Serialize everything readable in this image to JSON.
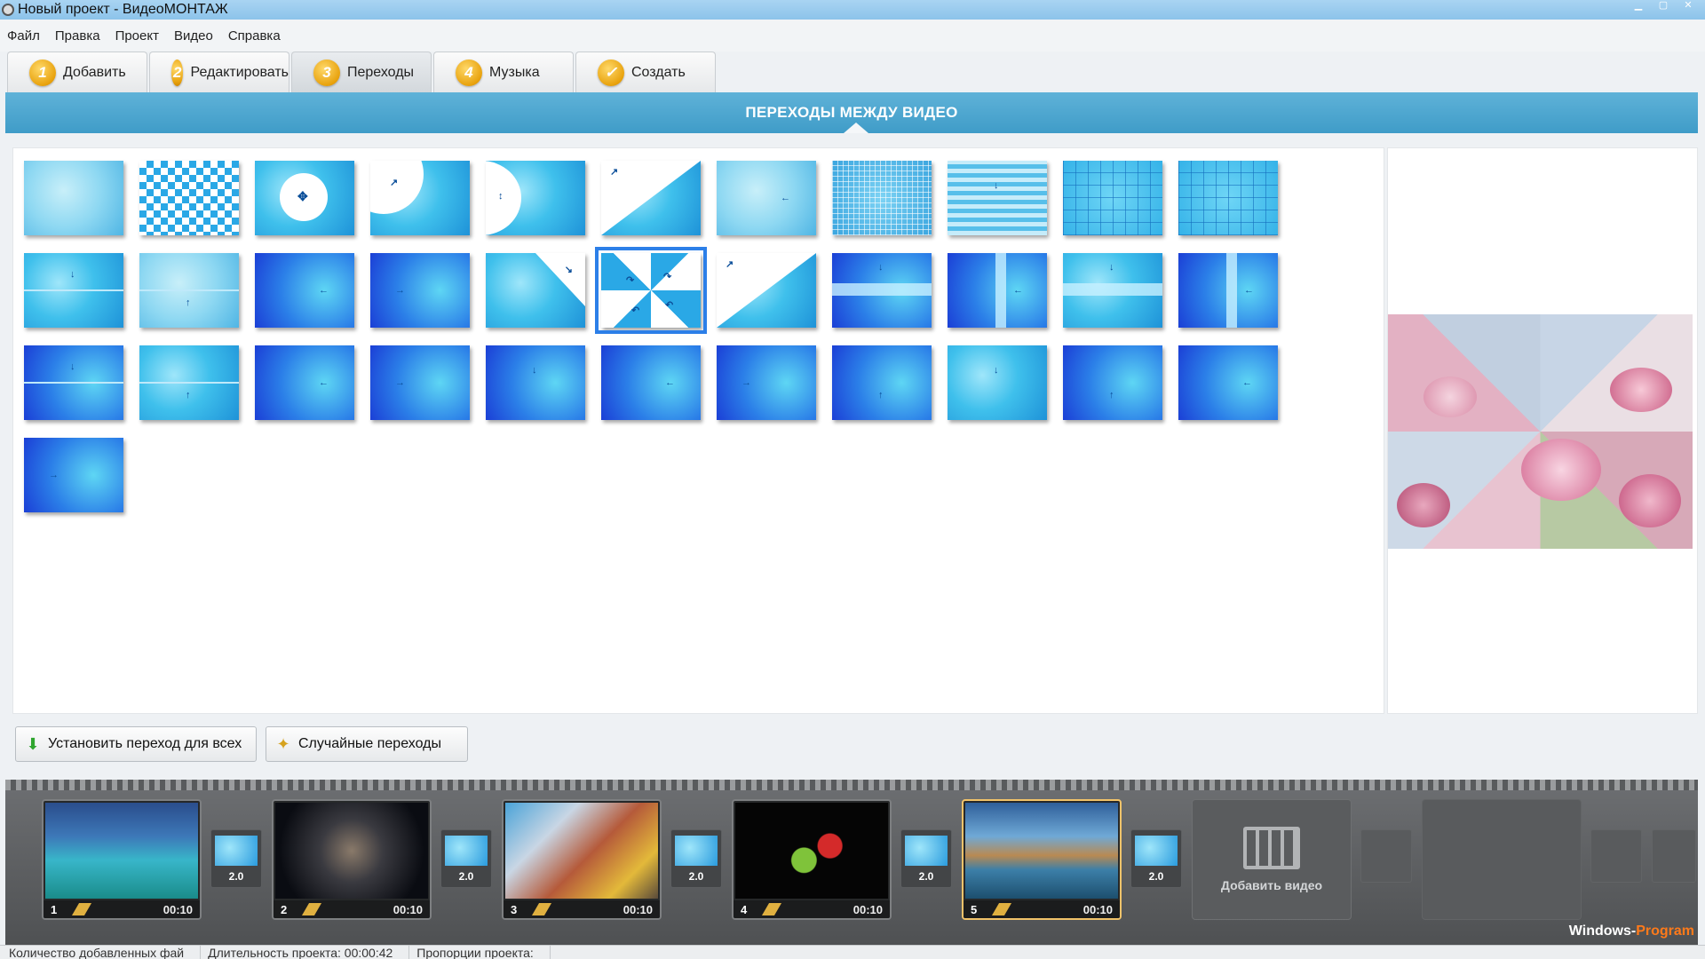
{
  "window": {
    "title": "Новый проект - ВидеоМОНТАЖ",
    "controls": [
      "minimize-icon",
      "restore-icon",
      "close-icon"
    ]
  },
  "menu": [
    "Файл",
    "Правка",
    "Проект",
    "Видео",
    "Справка"
  ],
  "tabs": [
    {
      "badge": "1",
      "label": "Добавить"
    },
    {
      "badge": "2",
      "label": "Редактировать"
    },
    {
      "badge": "3",
      "label": "Переходы",
      "active": true
    },
    {
      "badge": "4",
      "label": "Музыка"
    },
    {
      "badge": "✓",
      "label": "Создать"
    }
  ],
  "section": {
    "title": "ПЕРЕХОДЫ МЕЖДУ ВИДЕО"
  },
  "transitions": {
    "count": 34,
    "selected_index": 16
  },
  "buttons": {
    "apply_all": "Установить переход для всех",
    "random": "Случайные переходы"
  },
  "timeline": {
    "clips": [
      {
        "number": "1",
        "duration": "00:10"
      },
      {
        "number": "2",
        "duration": "00:10"
      },
      {
        "number": "3",
        "duration": "00:10"
      },
      {
        "number": "4",
        "duration": "00:10"
      },
      {
        "number": "5",
        "duration": "00:10",
        "active": true
      }
    ],
    "transition_durations": [
      "2.0",
      "2.0",
      "2.0",
      "2.0",
      "2.0"
    ],
    "add_video_label": "Добавить видео"
  },
  "watermark": {
    "part1": "Windows-",
    "part2": "Program"
  },
  "status": {
    "files_count": "Количество добавленных фай",
    "duration": "Длительность проекта: 00:00:42",
    "proportions": "Пропорции проекта:"
  },
  "colors": {
    "header_blue": "#4aa6d0",
    "tab_badge": "#e8a20d",
    "selection": "#2c7fe8",
    "watermark_accent": "#ff7a1a"
  }
}
